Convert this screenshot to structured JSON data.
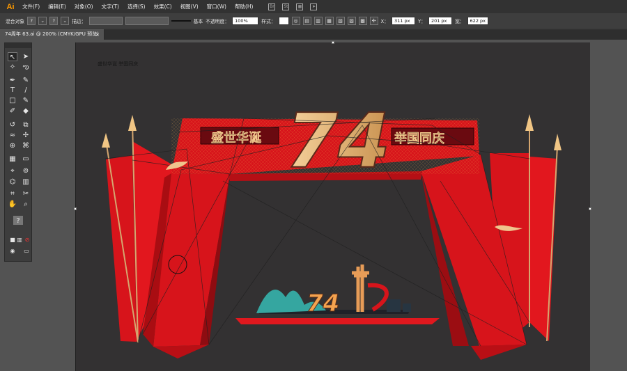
{
  "app": {
    "logo": "Ai",
    "menus": [
      "文件(F)",
      "编辑(E)",
      "对象(O)",
      "文字(T)",
      "选择(S)",
      "效果(C)",
      "视图(V)",
      "窗口(W)",
      "帮助(H)"
    ],
    "menu_icons": [
      "Br",
      "St"
    ]
  },
  "control_bar": {
    "mode": "混合对象",
    "stroke_label": "描边：",
    "stroke_style": "基本",
    "opacity_label": "不透明度：",
    "opacity_value": "100%",
    "style_label": "样式：",
    "x_label": "X：",
    "x_value": "311 px",
    "y_label": "Y：",
    "y_value": "201 px",
    "w_label": "宽：",
    "w_value": "622 px"
  },
  "document": {
    "tab_title": "74周年 63.ai @ 200% (CMYK/GPU 预览)",
    "close": "×"
  },
  "tools": {
    "question_mark": "?"
  },
  "artwork": {
    "big_number": "74",
    "left_banner": "盛世华诞",
    "right_banner": "举国同庆",
    "small_number": "74",
    "selected_top_text": "盛世华诞 举国同庆"
  },
  "colors": {
    "red": "#d7141b",
    "dark_red": "#a90d12",
    "gold": "#e4b878",
    "canvas": "#333132",
    "ui": "#3e3e3e"
  }
}
